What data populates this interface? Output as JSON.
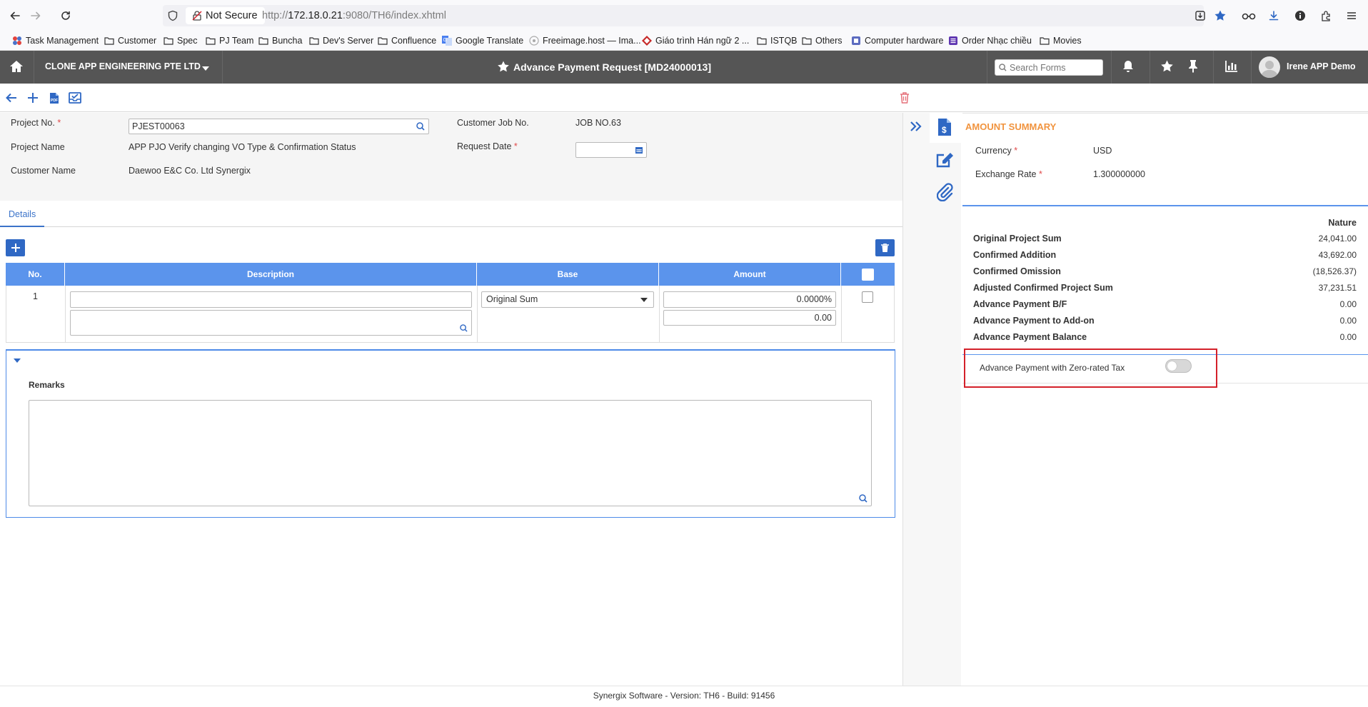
{
  "browser": {
    "not_secure": "Not Secure",
    "url_prefix": "http://",
    "url_host": "172.18.0.21",
    "url_rest": ":9080/TH6/index.xhtml"
  },
  "bookmarks": [
    {
      "label": "Task Management",
      "icon": "task-icon"
    },
    {
      "label": "Customer",
      "icon": "folder-icon"
    },
    {
      "label": "Spec",
      "icon": "folder-icon"
    },
    {
      "label": "PJ Team",
      "icon": "folder-icon"
    },
    {
      "label": "Buncha",
      "icon": "folder-icon"
    },
    {
      "label": "Dev's Server",
      "icon": "folder-icon"
    },
    {
      "label": "Confluence",
      "icon": "folder-icon"
    },
    {
      "label": "Google Translate",
      "icon": "translate-icon"
    },
    {
      "label": "Freeimage.host — Ima...",
      "icon": "freeimage-icon"
    },
    {
      "label": "Giáo trình Hán ngữ 2 ...",
      "icon": "diamond-icon"
    },
    {
      "label": "ISTQB",
      "icon": "folder-icon"
    },
    {
      "label": "Others",
      "icon": "folder-icon"
    },
    {
      "label": "Computer hardware",
      "icon": "hardware-icon"
    },
    {
      "label": "Order Nhạc chiều",
      "icon": "list-icon"
    },
    {
      "label": "Movies",
      "icon": "folder-icon"
    }
  ],
  "header": {
    "company": "CLONE APP ENGINEERING PTE LTD",
    "title": "Advance Payment Request [MD24000013]",
    "search_placeholder": "Search Forms",
    "user": "Irene APP Demo"
  },
  "form": {
    "project_no_label": "Project No.",
    "project_no_value": "PJEST00063",
    "project_name_label": "Project Name",
    "project_name_value": "APP PJO Verify changing VO Type & Confirmation Status",
    "customer_name_label": "Customer Name",
    "customer_name_value": "Daewoo E&C Co. Ltd Synergix",
    "customer_job_label": "Customer Job No.",
    "customer_job_value": "JOB NO.63",
    "request_date_label": "Request Date",
    "request_date_value": "",
    "required_mark": "*"
  },
  "tabs": {
    "details": "Details"
  },
  "table": {
    "headers": {
      "no": "No.",
      "description": "Description",
      "base": "Base",
      "amount": "Amount"
    },
    "rows": [
      {
        "no": "1",
        "description": "",
        "base": "Original Sum",
        "percent": "0.0000%",
        "amount": "0.00"
      }
    ]
  },
  "remarks": {
    "label": "Remarks",
    "value": ""
  },
  "summary": {
    "title": "AMOUNT SUMMARY",
    "currency_label": "Currency",
    "currency_value": "USD",
    "exchange_label": "Exchange Rate",
    "exchange_value": "1.300000000",
    "column_header": "Nature",
    "rows": [
      {
        "label": "Original Project Sum",
        "value": "24,041.00"
      },
      {
        "label": "Confirmed Addition",
        "value": "43,692.00"
      },
      {
        "label": "Confirmed Omission",
        "value": "(18,526.37)"
      },
      {
        "label": "Adjusted Confirmed Project Sum",
        "value": "37,231.51"
      },
      {
        "label": "Advance Payment B/F",
        "value": "0.00"
      },
      {
        "label": "Advance Payment to Add-on",
        "value": "0.00"
      },
      {
        "label": "Advance Payment Balance",
        "value": "0.00"
      }
    ],
    "toggle_label": "Advance Payment with Zero-rated Tax",
    "toggle_on": false
  },
  "footer": {
    "text": "Synergix Software - Version: TH6 - Build: 91456"
  },
  "colors": {
    "accent": "#2f68c4",
    "table_header": "#5b94ec",
    "summary_title": "#f1943f",
    "highlight": "#d4202a",
    "header_bg": "#555555"
  }
}
